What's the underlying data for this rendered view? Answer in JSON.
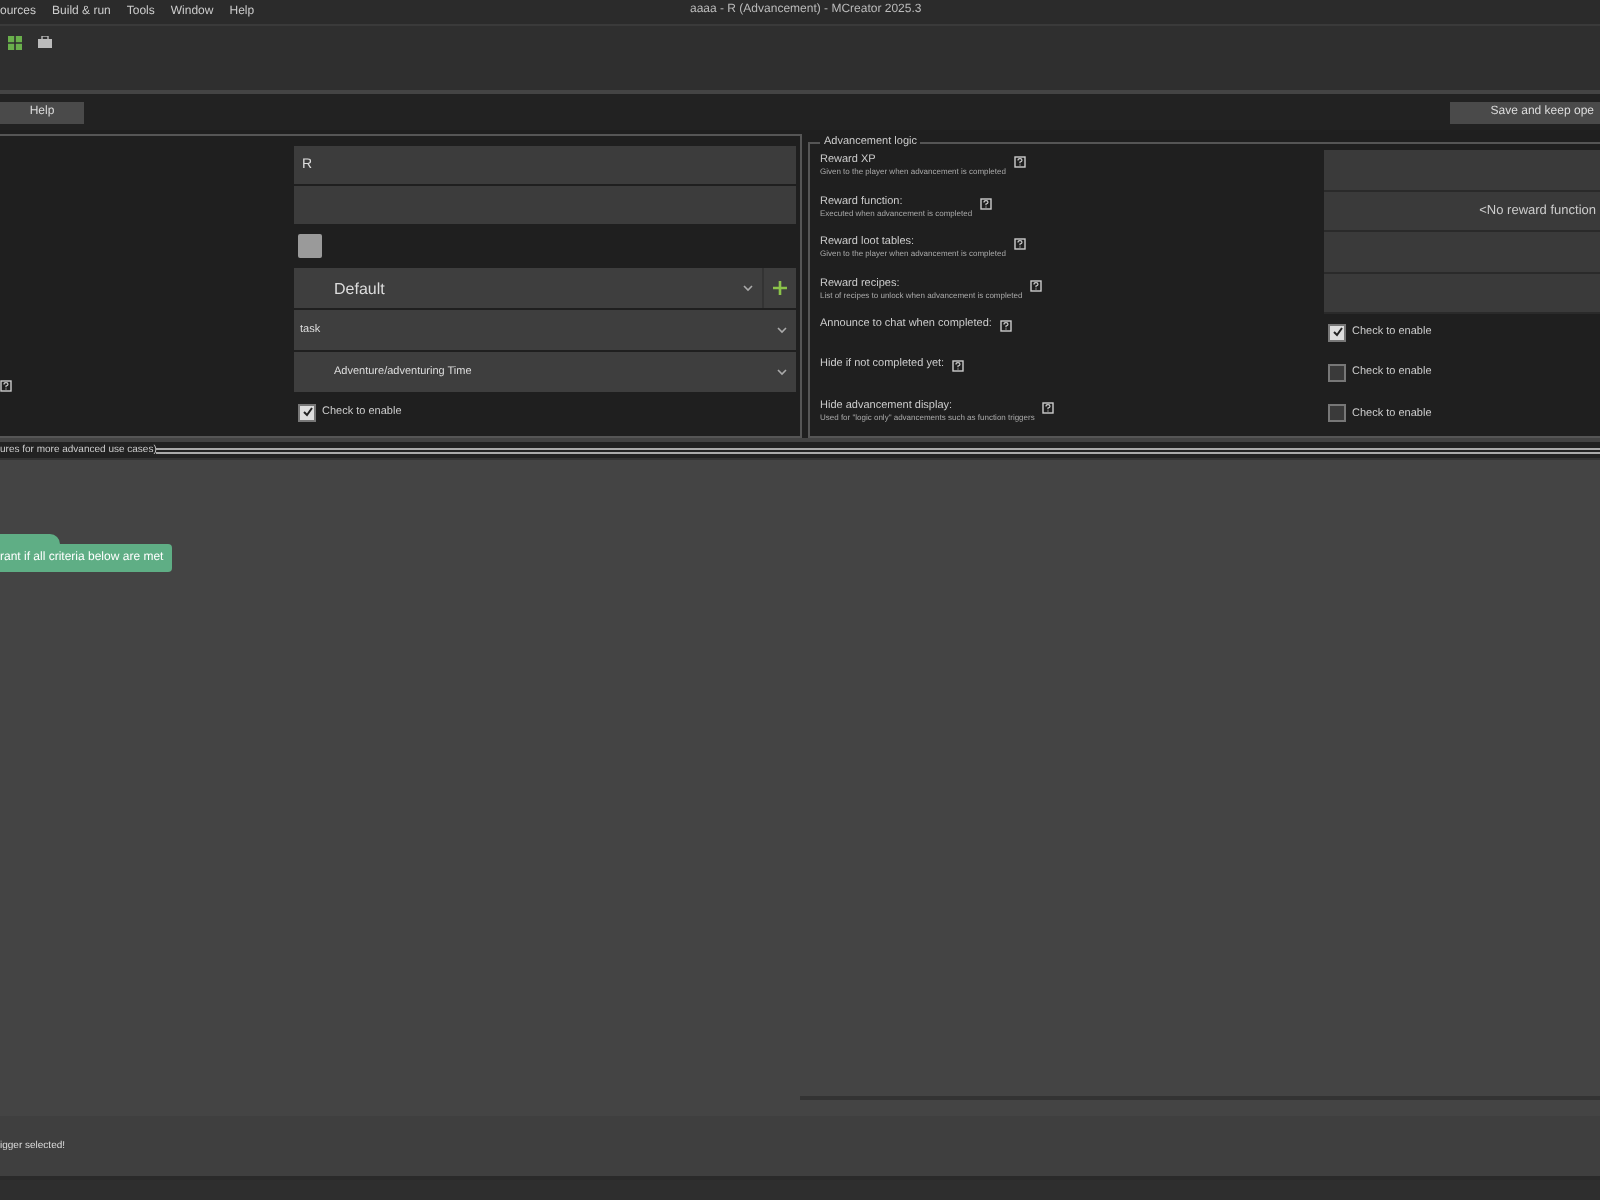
{
  "menu": [
    "ources",
    "Build & run",
    "Tools",
    "Window",
    "Help"
  ],
  "window": {
    "title": "aaaa - R (Advancement) - MCreator 2025.3"
  },
  "action_bar": {
    "help": "Help",
    "save": "Save and keep ope"
  },
  "properties": [
    {
      "kind": "text",
      "value": "R"
    },
    {
      "kind": "text"
    },
    {
      "kind": "swatch"
    },
    {
      "kind": "dropdown",
      "value": "Default",
      "add": true
    },
    {
      "kind": "dropdown",
      "value": "task"
    },
    {
      "kind": "dropdown",
      "value": "Adventure/adventuring Time",
      "indent": true
    },
    {
      "kind": "checkbox",
      "label": "Check to enable",
      "checked": true
    }
  ],
  "logic": {
    "title": "Advancement logic",
    "rows": [
      {
        "kind": "field",
        "label": "Reward XP",
        "hint": "Given to the player when advancement is completed"
      },
      {
        "kind": "select",
        "label": "Reward function:",
        "hint": "Executed when advancement is completed",
        "value": "<No reward function"
      },
      {
        "kind": "list",
        "label": "Reward loot tables:",
        "hint": "Given to the player when advancement is completed"
      },
      {
        "kind": "list",
        "label": "Reward recipes:",
        "hint": "List of recipes to unlock when advancement is completed"
      },
      {
        "kind": "checkbox",
        "label": "Announce to chat when completed:",
        "checkbox_label": "Check to enable",
        "checked": true
      },
      {
        "kind": "checkbox",
        "label": "Hide if not completed yet:",
        "checkbox_label": "Check to enable",
        "checked": false
      },
      {
        "kind": "checkbox",
        "label": "Hide advancement display:",
        "hint": "Used for \"logic only\" advancements such as function triggers",
        "checkbox_label": "Check to enable",
        "checked": false
      }
    ]
  },
  "section_title": "ures for more advanced use cases)",
  "canvas": {
    "block": "rant if all criteria below are met"
  },
  "status_bar": "igger selected!"
}
